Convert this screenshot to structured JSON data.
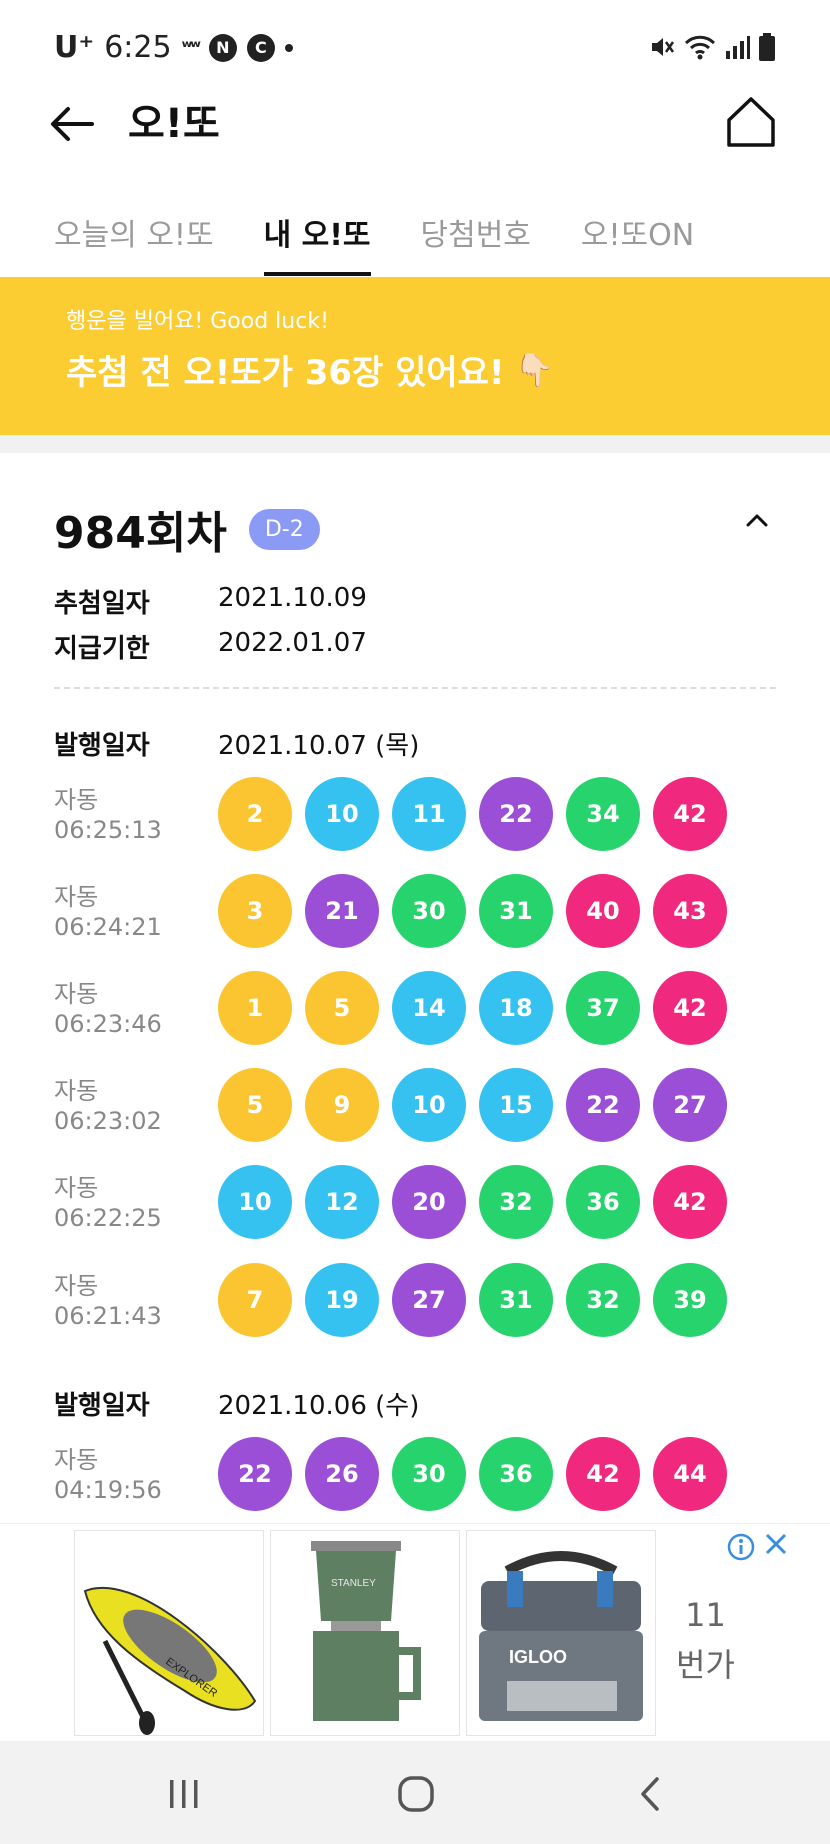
{
  "status_bar": {
    "carrier": "U⁺",
    "time": "6:25",
    "icons": [
      "notification-w-icon",
      "naver-icon",
      "c-icon",
      "dot-icon",
      "mute-icon",
      "wifi-icon",
      "signal-icon",
      "battery-icon"
    ]
  },
  "app_bar": {
    "title": "오!또"
  },
  "tabs": [
    {
      "label": "오늘의 오!또",
      "active": false
    },
    {
      "label": "내 오!또",
      "active": true
    },
    {
      "label": "당첨번호",
      "active": false
    },
    {
      "label": "오!또ON",
      "active": false
    }
  ],
  "banner": {
    "subtitle": "행운을 빌어요! Good luck!",
    "message": "추첨 전 오!또가 36장 있어요!",
    "emoji": "👇🏻"
  },
  "round": {
    "title": "984회차",
    "dday": "D-2",
    "draw_date_label": "추첨일자",
    "draw_date": "2021.10.09",
    "deadline_label": "지급기한",
    "deadline": "2022.01.07"
  },
  "issue_groups": [
    {
      "label": "발행일자",
      "date": "2021.10.07 (목)",
      "tickets": [
        {
          "type": "자동",
          "time": "06:25:13",
          "numbers": [
            2,
            10,
            11,
            22,
            34,
            42
          ]
        },
        {
          "type": "자동",
          "time": "06:24:21",
          "numbers": [
            3,
            21,
            30,
            31,
            40,
            43
          ]
        },
        {
          "type": "자동",
          "time": "06:23:46",
          "numbers": [
            1,
            5,
            14,
            18,
            37,
            42
          ]
        },
        {
          "type": "자동",
          "time": "06:23:02",
          "numbers": [
            5,
            9,
            10,
            15,
            22,
            27
          ]
        },
        {
          "type": "자동",
          "time": "06:22:25",
          "numbers": [
            10,
            12,
            20,
            32,
            36,
            42
          ]
        },
        {
          "type": "자동",
          "time": "06:21:43",
          "numbers": [
            7,
            19,
            27,
            31,
            32,
            39
          ]
        }
      ]
    },
    {
      "label": "발행일자",
      "date": "2021.10.06 (수)",
      "tickets": [
        {
          "type": "자동",
          "time": "04:19:56",
          "numbers": [
            22,
            26,
            30,
            36,
            42,
            44
          ]
        }
      ]
    }
  ],
  "ball_colors": {
    "1-9": "#fbc531",
    "10-19": "#35c2f0",
    "20-29": "#9b4fd6",
    "30-39": "#27d36c",
    "40-45": "#f0287e"
  },
  "ad": {
    "counter_top": "11",
    "counter_bottom": "번가",
    "items": [
      {
        "label": "EXPLORER"
      },
      {
        "label": "STANLEY"
      },
      {
        "label": "IGLOO"
      }
    ]
  }
}
